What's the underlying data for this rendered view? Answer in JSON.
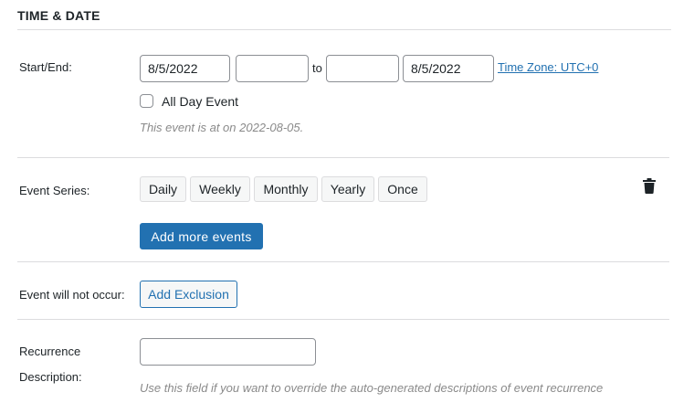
{
  "section": {
    "title": "TIME & DATE"
  },
  "start_end": {
    "label": "Start/End:",
    "start_date": "8/5/2022",
    "start_time": "",
    "to_label": "to",
    "end_time": "",
    "end_date": "8/5/2022",
    "timezone_link": "Time Zone: UTC+0",
    "all_day_label": "All Day Event",
    "all_day_checked": false,
    "summary": "This event is at on 2022-08-05."
  },
  "series": {
    "label": "Event Series:",
    "options": [
      "Daily",
      "Weekly",
      "Monthly",
      "Yearly",
      "Once"
    ],
    "add_more_label": "Add more events",
    "delete_icon": "trash-icon"
  },
  "exclusions": {
    "label": "Event will not occur:",
    "add_label": "Add Exclusion"
  },
  "recurrence": {
    "label_line1": "Recurrence",
    "label_line2": "Description:",
    "value": "",
    "hint": "Use this field if you want to override the auto-generated descriptions of event recurrence"
  },
  "colors": {
    "primary": "#2271b1",
    "border": "#8c8f94",
    "divider": "#dcdcde",
    "hint_text": "#8a8a8a"
  }
}
